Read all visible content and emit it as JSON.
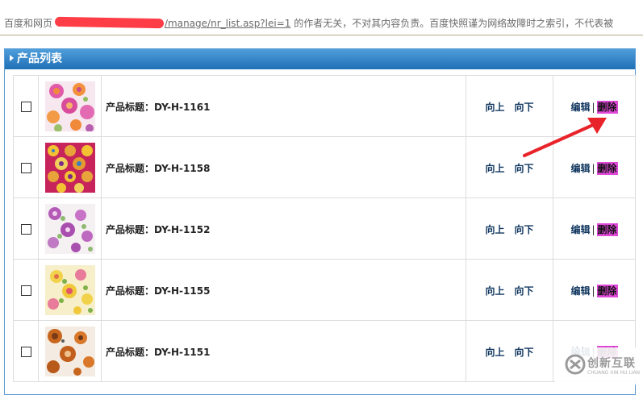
{
  "header": {
    "prefix": "百度和网页",
    "link_text": "/manage/nr_list.asp?lei=1",
    "suffix": "的作者无关，不对其内容负责。百度快照谨为网络故障时之索引，不代表被"
  },
  "panel": {
    "title": "产品列表"
  },
  "rows": [
    {
      "title": "产品标题：DY-H-1161",
      "up": "向上",
      "down": "向下",
      "edit": "编辑",
      "sep": "|",
      "delete": "删除",
      "thumb": "pink-orange-floral"
    },
    {
      "title": "产品标题：DY-H-1158",
      "up": "向上",
      "down": "向下",
      "edit": "编辑",
      "sep": "|",
      "delete": "删除",
      "thumb": "red-yellow-medallion"
    },
    {
      "title": "产品标题：DY-H-1152",
      "up": "向上",
      "down": "向下",
      "edit": "编辑",
      "sep": "|",
      "delete": "删除",
      "thumb": "purple-floral-white"
    },
    {
      "title": "产品标题：DY-H-1155",
      "up": "向上",
      "down": "向下",
      "edit": "编辑",
      "sep": "|",
      "delete": "删除",
      "thumb": "yellow-rose-floral"
    },
    {
      "title": "产品标题：DY-H-1151",
      "up": "向上",
      "down": "向下",
      "edit": "编辑",
      "sep": "|",
      "delete": "删除",
      "thumb": "brown-orange-floral"
    }
  ],
  "watermark": {
    "text": "创新互联",
    "sub": "CHUANG XIN HU LIAN"
  },
  "colors": {
    "header_blue": "#1f6fb6",
    "delete_highlight": "#e048d8",
    "arrow_red": "#e8232a"
  }
}
